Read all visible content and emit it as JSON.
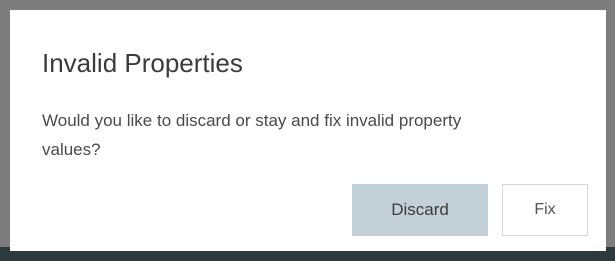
{
  "dialog": {
    "title": "Invalid Properties",
    "message": "Would you like to discard or stay and fix invalid property values?",
    "buttons": {
      "discard_label": "Discard",
      "fix_label": "Fix"
    }
  },
  "colors": {
    "overlay": "#7d7d7d",
    "dialog_bg": "#ffffff",
    "primary_button": "#c4d0d8",
    "secondary_button_border": "#d6d6d6",
    "text": "#3b3b3b"
  }
}
